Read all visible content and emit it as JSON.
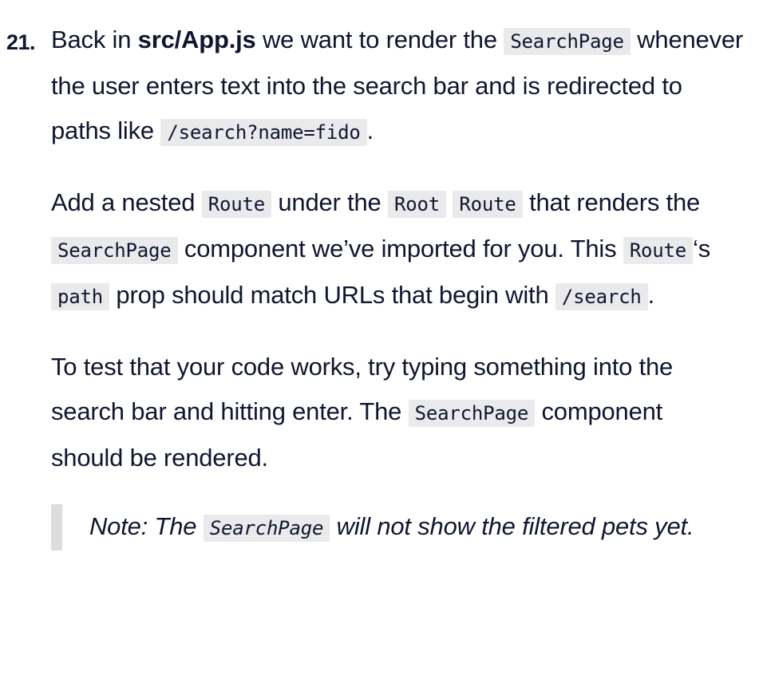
{
  "step": {
    "number": "21.",
    "p1": {
      "t1": "Back in ",
      "file": "src/App.js",
      "t2": " we want to render the ",
      "code1": "SearchPage",
      "t3": " whenever the user enters text into the search bar and is redirected to paths like ",
      "code2": "/search?name=fido",
      "t4": "."
    },
    "p2": {
      "t1": "Add a nested ",
      "code1": "Route",
      "t2": " under the ",
      "code2": "Root",
      "t3": " ",
      "code3": "Route",
      "t4": " that renders the ",
      "code4": "SearchPage",
      "t5": " component we’ve imported for you. This ",
      "code5": "Route",
      "t6": "‘s ",
      "code6": "path",
      "t7": " prop should match URLs that begin with ",
      "code7": "/search",
      "t8": "."
    },
    "p3": {
      "t1": "To test that your code works, try typing something into the search bar and hitting enter. The ",
      "code1": "SearchPage",
      "t2": " component should be rendered."
    },
    "note": {
      "t1": "Note: The ",
      "code1": "SearchPage",
      "t2": " will not show the filtered pets yet."
    }
  },
  "colors": {
    "text": "#10162f",
    "code_background": "#eaeaec",
    "note_border": "#dcdcdf"
  }
}
